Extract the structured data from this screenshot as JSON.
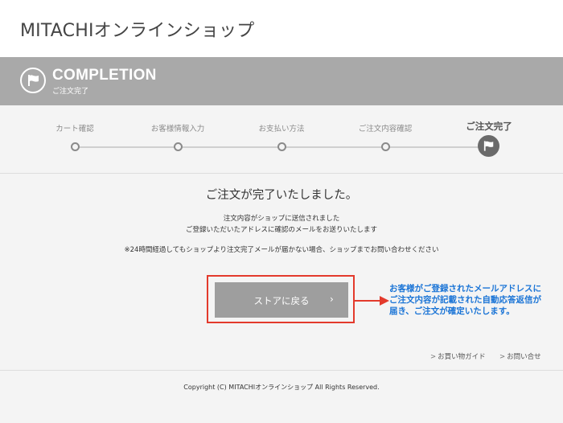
{
  "header": {
    "site_title": "MITACHIオンラインショップ"
  },
  "banner": {
    "title": "COMPLETION",
    "subtitle": "ご注文完了",
    "icon": "flag-icon"
  },
  "steps": [
    {
      "label": "カート確認",
      "current": false
    },
    {
      "label": "お客様情報入力",
      "current": false
    },
    {
      "label": "お支払い方法",
      "current": false
    },
    {
      "label": "ご注文内容確認",
      "current": false
    },
    {
      "label": "ご注文完了",
      "current": true
    }
  ],
  "main": {
    "heading": "ご注文が完了いたしました。",
    "message_line1": "注文内容がショップに送信されました",
    "message_line2": "ご登録いただいたアドレスに確認のメールをお送りいたします",
    "notice": "※24時間経過してもショップより注文完了メールが届かない場合、ショップまでお問い合わせください",
    "store_button_label": "ストアに戻る",
    "store_button_chevron": "›"
  },
  "annotation": {
    "line1": "お客様がご登録されたメールアドレスに",
    "line2": "ご注文内容が記載された自動応答返信が",
    "line3": "届き、ご注文が確定いたします。",
    "color": "#1a74d6",
    "highlight_color": "#e33a2c"
  },
  "footer": {
    "link_guide": "お買い物ガイド",
    "link_contact": "お問い合せ",
    "link_prefix": ">",
    "copyright": "Copyright (C) MITACHIオンラインショップ All Rights Reserved."
  }
}
